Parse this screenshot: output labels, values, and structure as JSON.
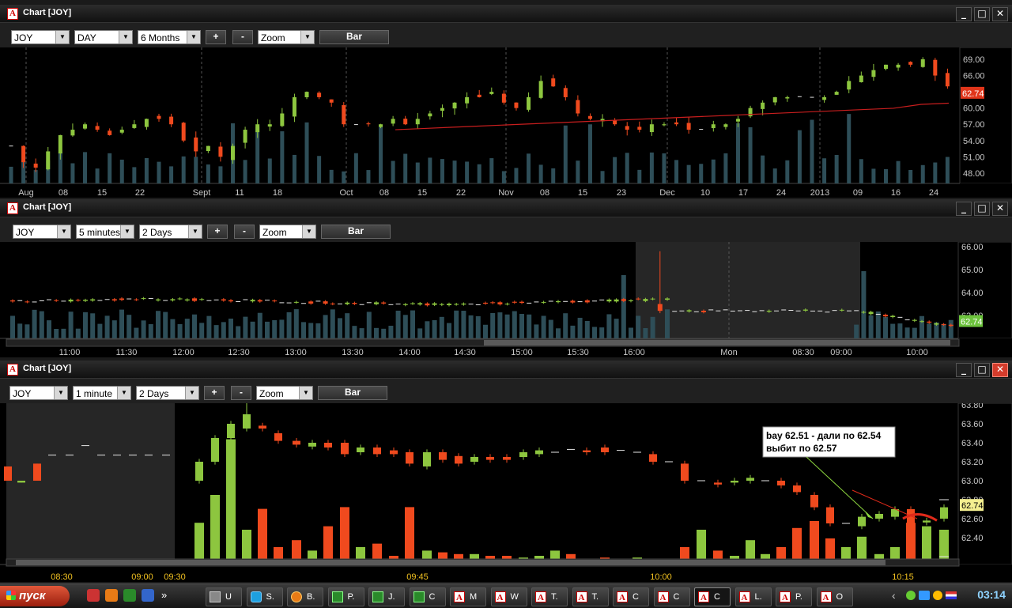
{
  "windows": [
    {
      "title": "Chart [JOY]",
      "symbol": "JOY",
      "interval": "DAY",
      "range": "6 Months",
      "zoom_label": "Zoom",
      "plus": "+",
      "minus": "-",
      "bar_label": "Bar",
      "price_axis": [
        "69.00",
        "66.00",
        "63.00",
        "60.00",
        "57.00",
        "54.00",
        "51.00",
        "48.00"
      ],
      "last_price": "62.74",
      "time_axis": [
        "Aug",
        "08",
        "15",
        "22",
        "Sept",
        "11",
        "18",
        "Oct",
        "08",
        "15",
        "22",
        "Nov",
        "08",
        "15",
        "23",
        "Dec",
        "10",
        "17",
        "24",
        "2013",
        "09",
        "16",
        "24"
      ]
    },
    {
      "title": "Chart [JOY]",
      "symbol": "JOY",
      "interval": "5 minutes",
      "range": "2 Days",
      "zoom_label": "Zoom",
      "plus": "+",
      "minus": "-",
      "bar_label": "Bar",
      "price_axis": [
        "66.00",
        "65.00",
        "64.00",
        "63.00"
      ],
      "last_price": "62.74",
      "time_axis": [
        "11:00",
        "11:30",
        "12:00",
        "12:30",
        "13:00",
        "13:30",
        "14:00",
        "14:30",
        "15:00",
        "15:30",
        "16:00",
        "Mon",
        "08:30",
        "09:00",
        "10:00"
      ]
    },
    {
      "title": "Chart [JOY]",
      "symbol": "JOY",
      "interval": "1 minute",
      "range": "2 Days",
      "zoom_label": "Zoom",
      "plus": "+",
      "minus": "-",
      "bar_label": "Bar",
      "price_axis": [
        "63.80",
        "63.60",
        "63.40",
        "63.20",
        "63.00",
        "62.80",
        "62.60",
        "62.40"
      ],
      "last_price": "62.74",
      "time_axis": [
        "08:30",
        "09:00",
        "09:30",
        "09:45",
        "10:00",
        "10:15"
      ],
      "annotation": [
        "bay 62.51 - дали по 62.54",
        "выбит по 62.57"
      ]
    }
  ],
  "window_controls": {
    "minimize": "_",
    "maximize": "□",
    "close": "✕"
  },
  "taskbar": {
    "start_label": "пуск",
    "quick_launch": [
      "opera-icon",
      "firefox-icon",
      "excel-icon",
      "save-icon"
    ],
    "overflow": "»",
    "items": [
      {
        "icon": "u",
        "label": "U"
      },
      {
        "icon": "s",
        "label": "S."
      },
      {
        "icon": "f",
        "label": "B."
      },
      {
        "icon": "g",
        "label": "P."
      },
      {
        "icon": "g",
        "label": "J."
      },
      {
        "icon": "g",
        "label": "C"
      },
      {
        "icon": "a",
        "label": "M"
      },
      {
        "icon": "a",
        "label": "W"
      },
      {
        "icon": "a",
        "label": "T."
      },
      {
        "icon": "a",
        "label": "T."
      },
      {
        "icon": "a",
        "label": "C"
      },
      {
        "icon": "a",
        "label": "C"
      },
      {
        "icon": "a",
        "label": "C"
      },
      {
        "icon": "a",
        "label": "L."
      },
      {
        "icon": "a",
        "label": "P."
      },
      {
        "icon": "a",
        "label": "O"
      }
    ],
    "clock": "03:14",
    "tray_arrow": "‹"
  },
  "colors": {
    "up": "#8dc63f",
    "down": "#f04a1e",
    "volume": "#2e4e58",
    "ma": "#c81e1e",
    "grid": "#555555"
  }
}
